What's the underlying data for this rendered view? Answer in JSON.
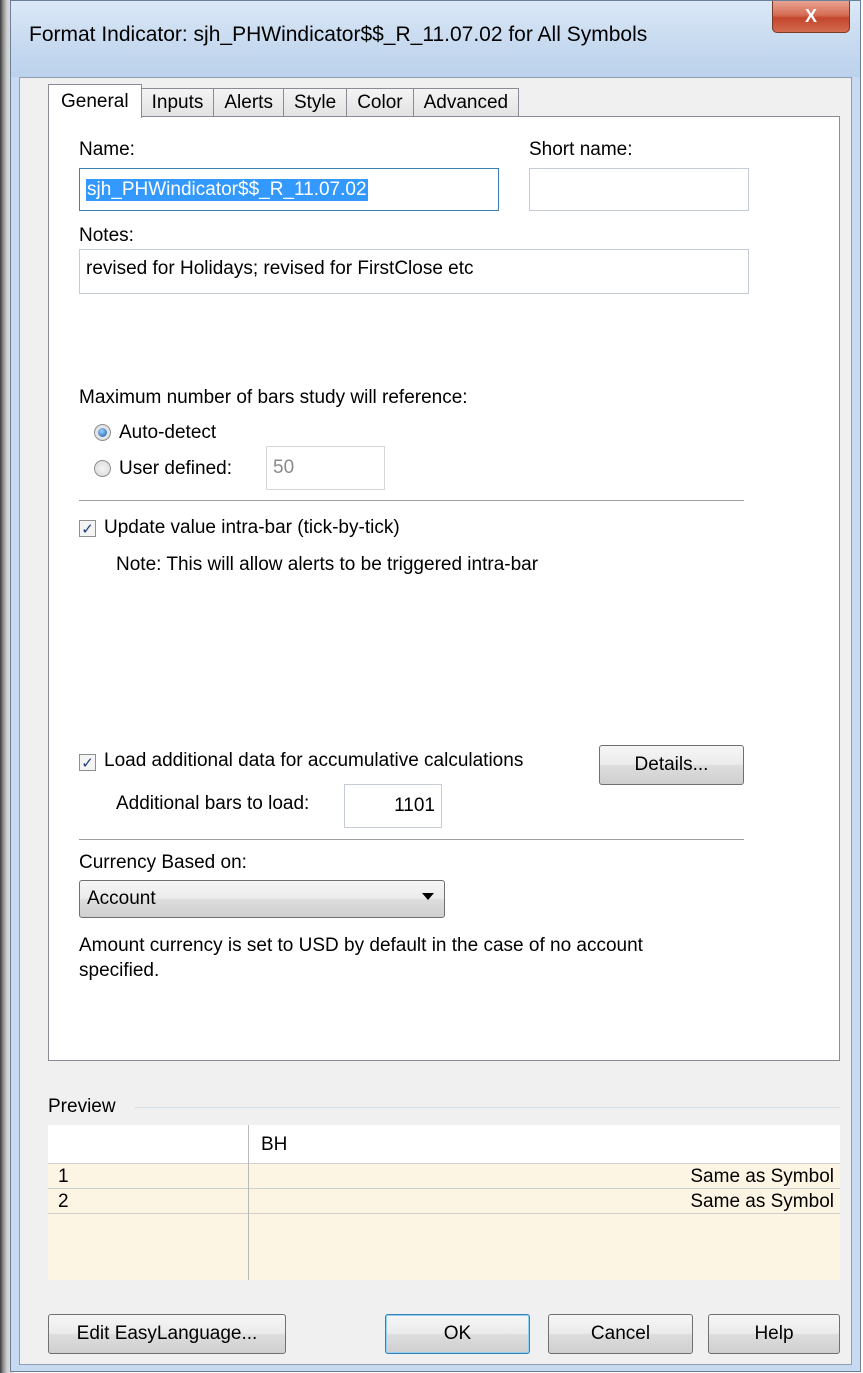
{
  "window": {
    "title": "Format Indicator: sjh_PHWindicator$$_R_11.07.02 for All Symbols",
    "close_glyph": "X"
  },
  "tabs": [
    {
      "label": "General",
      "active": true
    },
    {
      "label": "Inputs"
    },
    {
      "label": "Alerts"
    },
    {
      "label": "Style"
    },
    {
      "label": "Color"
    },
    {
      "label": "Advanced"
    }
  ],
  "general": {
    "name_label": "Name:",
    "name_value": "sjh_PHWindicator$$_R_11.07.02",
    "short_name_label": "Short name:",
    "short_name_value": "",
    "notes_label": "Notes:",
    "notes_value": "revised for Holidays; revised for FirstClose etc",
    "max_bars_label": "Maximum number of bars study will reference:",
    "auto_detect_label": "Auto-detect",
    "user_defined_label": "User defined:",
    "user_defined_value": "50",
    "update_intrabar_label": "Update value intra-bar (tick-by-tick)",
    "update_intrabar_note": "Note: This will allow alerts to be triggered intra-bar",
    "load_additional_label": "Load additional data for accumulative calculations",
    "details_button": "Details...",
    "additional_bars_label": "Additional bars to load:",
    "additional_bars_value": "1101",
    "currency_label": "Currency Based on:",
    "currency_selected": "Account",
    "currency_note_line1": "Amount currency is set to USD by default in the case of no account",
    "currency_note_line2": "specified."
  },
  "preview": {
    "label": "Preview",
    "column_header": "BH",
    "rows": [
      {
        "num": "1",
        "value": "Same as Symbol"
      },
      {
        "num": "2",
        "value": "Same as Symbol"
      }
    ]
  },
  "footer": {
    "edit_button": "Edit EasyLanguage...",
    "ok_button": "OK",
    "cancel_button": "Cancel",
    "help_button": "Help"
  },
  "checkmark_glyph": "✓",
  "colors": {
    "selection": "#3399ff",
    "preview_bg": "#fdf5e4",
    "title_bar": "#c6d9ef",
    "close_red": "#c2462c"
  }
}
